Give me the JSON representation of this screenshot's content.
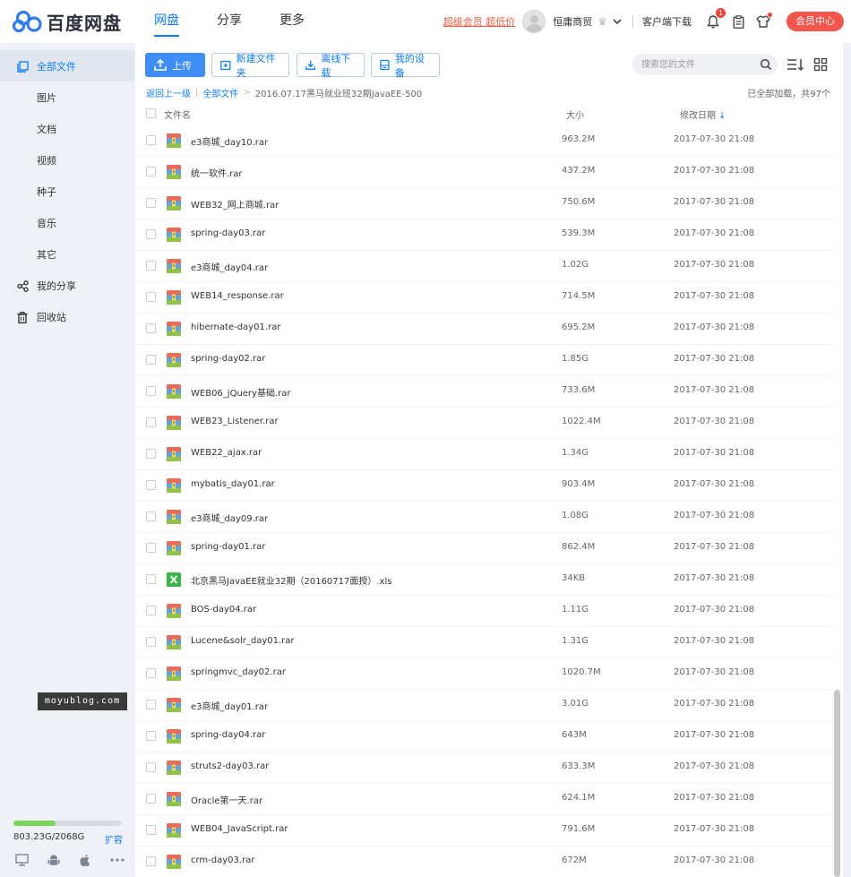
{
  "header": {
    "logo_text": "百度网盘",
    "nav": [
      "网盘",
      "分享",
      "更多"
    ],
    "vip_link": "超级会员 超低价",
    "username": "恒庸商贸",
    "client_download": "客户端下载",
    "notification_count": "1",
    "member_center": "会员中心"
  },
  "sidebar": {
    "items": [
      {
        "label": "全部文件",
        "icon": "all-files-icon"
      },
      {
        "label": "图片",
        "icon": ""
      },
      {
        "label": "文档",
        "icon": ""
      },
      {
        "label": "视频",
        "icon": ""
      },
      {
        "label": "种子",
        "icon": ""
      },
      {
        "label": "音乐",
        "icon": ""
      },
      {
        "label": "其它",
        "icon": ""
      },
      {
        "label": "我的分享",
        "icon": "share-icon"
      },
      {
        "label": "回收站",
        "icon": "trash-icon"
      }
    ],
    "storage_text": "803.23G/2068G",
    "storage_used_fraction": 0.388,
    "expand_label": "扩容"
  },
  "toolbar": {
    "upload": "上传",
    "new_folder": "新建文件夹",
    "offline_download": "离线下载",
    "my_devices": "我的设备",
    "search_placeholder": "搜索您的文件"
  },
  "breadcrumb": {
    "back": "返回上一级",
    "all_files": "全部文件",
    "current": "2016.07.17黑马就业班32期JavaEE-500",
    "loaded_text": "已全部加载，共97个"
  },
  "columns": {
    "name": "文件名",
    "size": "大小",
    "date": "修改日期"
  },
  "files": [
    {
      "name": "e3商城_day10.rar",
      "size": "963.2M",
      "date": "2017-07-30 21:08",
      "type": "rar"
    },
    {
      "name": "统一软件.rar",
      "size": "437.2M",
      "date": "2017-07-30 21:08",
      "type": "rar"
    },
    {
      "name": "WEB32_网上商城.rar",
      "size": "750.6M",
      "date": "2017-07-30 21:08",
      "type": "rar"
    },
    {
      "name": "spring-day03.rar",
      "size": "539.3M",
      "date": "2017-07-30 21:08",
      "type": "rar"
    },
    {
      "name": "e3商城_day04.rar",
      "size": "1.02G",
      "date": "2017-07-30 21:08",
      "type": "rar"
    },
    {
      "name": "WEB14_response.rar",
      "size": "714.5M",
      "date": "2017-07-30 21:08",
      "type": "rar"
    },
    {
      "name": "hibernate-day01.rar",
      "size": "695.2M",
      "date": "2017-07-30 21:08",
      "type": "rar"
    },
    {
      "name": "spring-day02.rar",
      "size": "1.85G",
      "date": "2017-07-30 21:08",
      "type": "rar"
    },
    {
      "name": "WEB06_jQuery基础.rar",
      "size": "733.6M",
      "date": "2017-07-30 21:08",
      "type": "rar"
    },
    {
      "name": "WEB23_Listener.rar",
      "size": "1022.4M",
      "date": "2017-07-30 21:08",
      "type": "rar"
    },
    {
      "name": "WEB22_ajax.rar",
      "size": "1.34G",
      "date": "2017-07-30 21:08",
      "type": "rar"
    },
    {
      "name": "mybatis_day01.rar",
      "size": "903.4M",
      "date": "2017-07-30 21:08",
      "type": "rar"
    },
    {
      "name": "e3商城_day09.rar",
      "size": "1.08G",
      "date": "2017-07-30 21:08",
      "type": "rar"
    },
    {
      "name": "spring-day01.rar",
      "size": "862.4M",
      "date": "2017-07-30 21:08",
      "type": "rar"
    },
    {
      "name": "北京黑马JavaEE就业32期（20160717面授）.xls",
      "size": "34KB",
      "date": "2017-07-30 21:08",
      "type": "xls"
    },
    {
      "name": "BOS-day04.rar",
      "size": "1.11G",
      "date": "2017-07-30 21:08",
      "type": "rar"
    },
    {
      "name": "Lucene&solr_day01.rar",
      "size": "1.31G",
      "date": "2017-07-30 21:08",
      "type": "rar"
    },
    {
      "name": "springmvc_day02.rar",
      "size": "1020.7M",
      "date": "2017-07-30 21:08",
      "type": "rar"
    },
    {
      "name": "e3商城_day01.rar",
      "size": "3.01G",
      "date": "2017-07-30 21:08",
      "type": "rar"
    },
    {
      "name": "spring-day04.rar",
      "size": "643M",
      "date": "2017-07-30 21:08",
      "type": "rar"
    },
    {
      "name": "struts2-day03.rar",
      "size": "633.3M",
      "date": "2017-07-30 21:08",
      "type": "rar"
    },
    {
      "name": "Oracle第一天.rar",
      "size": "624.1M",
      "date": "2017-07-30 21:08",
      "type": "rar"
    },
    {
      "name": "WEB04_JavaScript.rar",
      "size": "791.6M",
      "date": "2017-07-30 21:08",
      "type": "rar"
    },
    {
      "name": "crm-day03.rar",
      "size": "672M",
      "date": "2017-07-30 21:08",
      "type": "rar"
    }
  ],
  "watermark": "moyublog.com",
  "colors": {
    "accent": "#0c7eff",
    "member_button": "#f5554a",
    "storage_fill": "#7ed35a"
  }
}
